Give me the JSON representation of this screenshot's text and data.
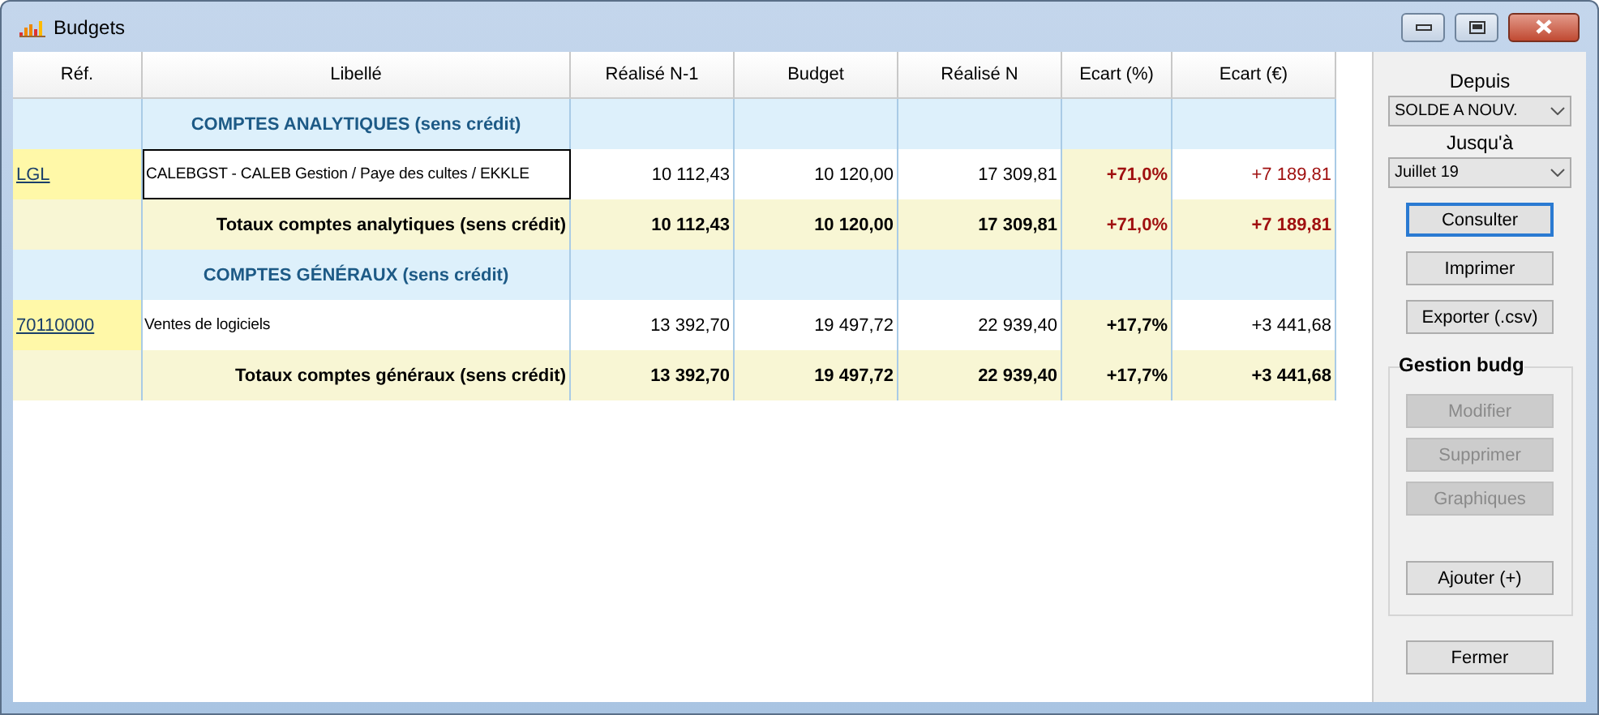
{
  "window": {
    "title": "Budgets"
  },
  "table": {
    "columns": [
      "Réf.",
      "Libellé",
      "Réalisé N-1",
      "Budget",
      "Réalisé N",
      "Ecart (%)",
      "Ecart (€)"
    ],
    "rows": [
      {
        "kind": "section",
        "label": "COMPTES ANALYTIQUES (sens crédit)"
      },
      {
        "kind": "data",
        "ref": "LGL",
        "label": "CALEBGST - CALEB Gestion / Paye des cultes / EKKLE",
        "focused": true,
        "values": [
          "10 112,43",
          "10 120,00",
          "17 309,81"
        ],
        "ecart_pct": "+71,0%",
        "ecart_eur": "+7 189,81",
        "alert": true
      },
      {
        "kind": "total",
        "label": "Totaux comptes analytiques (sens crédit)",
        "values": [
          "10 112,43",
          "10 120,00",
          "17 309,81"
        ],
        "ecart_pct": "+71,0%",
        "ecart_eur": "+7 189,81",
        "alert": true
      },
      {
        "kind": "section",
        "label": "COMPTES GÉNÉRAUX (sens crédit)"
      },
      {
        "kind": "data",
        "ref": "70110000",
        "label": "Ventes de logiciels",
        "focused": false,
        "values": [
          "13 392,70",
          "19 497,72",
          "22 939,40"
        ],
        "ecart_pct": "+17,7%",
        "ecart_eur": "+3 441,68",
        "alert": false
      },
      {
        "kind": "total",
        "label": "Totaux comptes généraux (sens crédit)",
        "values": [
          "13 392,70",
          "19 497,72",
          "22 939,40"
        ],
        "ecart_pct": "+17,7%",
        "ecart_eur": "+3 441,68",
        "alert": false
      }
    ]
  },
  "panel": {
    "from_label": "Depuis",
    "from_value": "SOLDE A NOUV.",
    "to_label": "Jusqu'à",
    "to_value": "Juillet 19",
    "buttons": [
      {
        "label": "Consulter",
        "default": true
      },
      {
        "label": "Imprimer",
        "default": false
      },
      {
        "label": "Exporter (.csv)",
        "default": false
      }
    ],
    "group": {
      "title": "Gestion budg",
      "buttons": [
        {
          "label": "Modifier",
          "disabled": true
        },
        {
          "label": "Supprimer",
          "disabled": true
        },
        {
          "label": "Graphiques",
          "disabled": true
        },
        {
          "label": "Ajouter (+)",
          "disabled": false
        }
      ]
    },
    "close": "Fermer"
  }
}
